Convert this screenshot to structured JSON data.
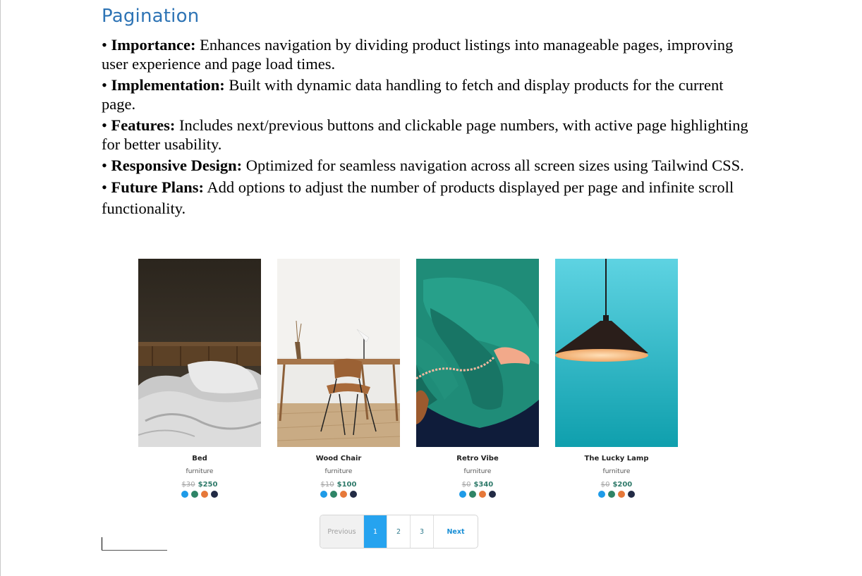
{
  "heading": "Pagination",
  "bullets": [
    {
      "label": "Importance:",
      "text": " Enhances navigation by dividing product listings into manageable pages, improving user experience and page load times."
    },
    {
      "label": "Implementation:",
      "text": " Built with dynamic data handling to fetch and display products for the current page."
    },
    {
      "label": "Features:",
      "text": " Includes next/previous buttons and clickable page numbers, with active page highlighting for better usability."
    },
    {
      "label": "Responsive Design:",
      "text": " Optimized for seamless navigation across all screen sizes using Tailwind CSS."
    },
    {
      "label": "Future Plans:",
      "text": " Add options to adjust the number of products displayed per page and infinite scroll functionality."
    }
  ],
  "products": [
    {
      "name": "Bed",
      "category": "furniture",
      "old_price": "$30",
      "price": "$250"
    },
    {
      "name": "Wood Chair",
      "category": "furniture",
      "old_price": "$10",
      "price": "$100"
    },
    {
      "name": "Retro Vibe",
      "category": "furniture",
      "old_price": "$0",
      "price": "$340"
    },
    {
      "name": "The Lucky Lamp",
      "category": "furniture",
      "old_price": "$0",
      "price": "$200"
    }
  ],
  "swatch_colors": [
    "#1e9be8",
    "#2e8466",
    "#e67839",
    "#222b45"
  ],
  "pagination": {
    "previous": "Previous",
    "pages": [
      "1",
      "2",
      "3"
    ],
    "active_page": "1",
    "next": "Next"
  }
}
